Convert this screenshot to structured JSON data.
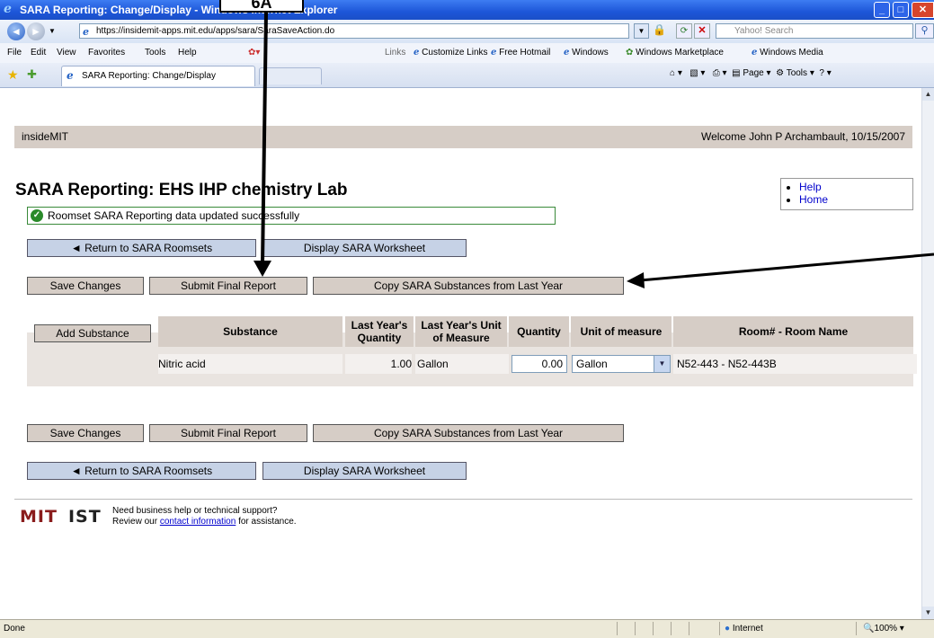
{
  "browser": {
    "window_title": "SARA Reporting: Change/Display - Windows Internet Explorer",
    "url": "https://insidemit-apps.mit.edu/apps/sara/SaraSaveAction.do",
    "search_placeholder": "Yahoo! Search",
    "menu": [
      "File",
      "Edit",
      "View",
      "Favorites",
      "Tools",
      "Help"
    ],
    "links_label": "Links",
    "links": [
      "Customize Links",
      "Free Hotmail",
      "Windows",
      "Windows Marketplace",
      "Windows Media"
    ],
    "tab_title": "SARA Reporting: Change/Display",
    "commands": [
      "Page",
      "Tools"
    ],
    "status_text": "Done",
    "zone_text": "Internet",
    "zoom_text": "100%"
  },
  "page": {
    "brand": "insideMIT",
    "welcome": "Welcome John P Archambault, 10/15/2007",
    "title": "SARA Reporting: EHS IHP chemistry Lab",
    "help_links": [
      "Help",
      "Home"
    ],
    "success_message": "Roomset SARA Reporting data updated successfully",
    "nav_buttons": {
      "return": "◄ Return to SARA Roomsets",
      "worksheet": "Display SARA Worksheet"
    },
    "action_buttons": {
      "save": "Save Changes",
      "submit": "Submit Final Report",
      "copy": "Copy SARA Substances from Last Year"
    },
    "add_substance": "Add Substance",
    "table": {
      "headers": [
        "Substance",
        "Last Year's Quantity",
        "Last Year's Unit of Measure",
        "Quantity",
        "Unit of measure",
        "Room# - Room Name"
      ],
      "rows": [
        {
          "substance": "Nitric acid",
          "last_qty": "1.00",
          "last_unit": "Gallon",
          "quantity": "0.00",
          "unit": "Gallon",
          "room": "N52-443 - N52-443B"
        }
      ]
    },
    "footer": {
      "logo_mit": "MIT",
      "logo_ist": "IST",
      "line1": "Need business help or technical support?",
      "line2_pre": "Review our ",
      "line2_link": "contact information",
      "line2_post": " for assistance."
    }
  },
  "annotation": {
    "callout_label": "6A"
  }
}
